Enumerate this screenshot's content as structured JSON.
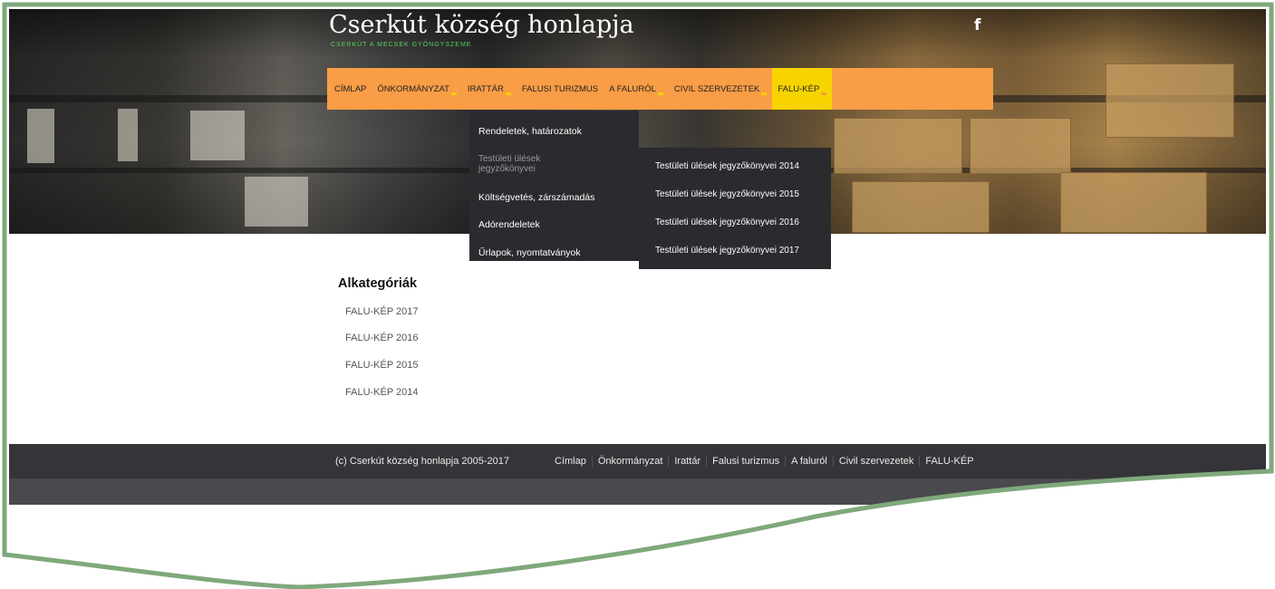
{
  "header": {
    "site_title": "Cserkút község honlapja",
    "site_subtitle": "CSERKÚT A MECSEK GYÖNGYSZEME",
    "social_icon": "facebook-icon",
    "social_glyph": "f"
  },
  "nav": {
    "items": [
      {
        "label": "CÍMLAP",
        "has_caret": false
      },
      {
        "label": "ÖNKORMÁNYZAT",
        "has_caret": true
      },
      {
        "label": "IRATTÁR",
        "has_caret": true
      },
      {
        "label": "FALUSI TURIZMUS",
        "has_caret": false
      },
      {
        "label": "A FALURÓL",
        "has_caret": true
      },
      {
        "label": "CIVIL SZERVEZETEK",
        "has_caret": true
      },
      {
        "label": "FALU-KÉP",
        "has_caret": true
      }
    ],
    "active": "FALU-KÉP"
  },
  "dropdown": {
    "items": [
      {
        "label": "Rendeletek, határozatok"
      },
      {
        "label": "Testületi ülések jegyzőkönyvei"
      },
      {
        "label": "Költségvetés, zárszámadás"
      },
      {
        "label": "Adórendeletek"
      },
      {
        "label": "Űrlapok, nyomtatványok"
      }
    ]
  },
  "submenu": {
    "items": [
      {
        "label": "Testületi ülések jegyzőkönyvei 2014"
      },
      {
        "label": "Testületi ülések jegyzőkönyvei 2015"
      },
      {
        "label": "Testületi ülések jegyzőkönyvei 2016"
      },
      {
        "label": "Testületi ülések jegyzőkönyvei 2017"
      }
    ]
  },
  "main": {
    "section_title": "Alkategóriák",
    "categories": [
      "FALU-KÉP 2017",
      "FALU-KÉP 2016",
      "FALU-KÉP 2015",
      "FALU-KÉP 2014"
    ]
  },
  "footer": {
    "copyright": "(c) Cserkút község honlapja 2005-2017",
    "links": [
      "Címlap",
      "Önkormányzat",
      "Irattár",
      "Falusi turizmus",
      "A faluról",
      "Civil szervezetek",
      "FALU-KÉP"
    ]
  },
  "colors": {
    "nav_bg": "#f99d46",
    "nav_active": "#f7d300",
    "dropdown_bg": "#2b2a2e",
    "footer_bg": "#353438",
    "frame_border": "#7fa87b",
    "subtitle": "#55d35a"
  }
}
